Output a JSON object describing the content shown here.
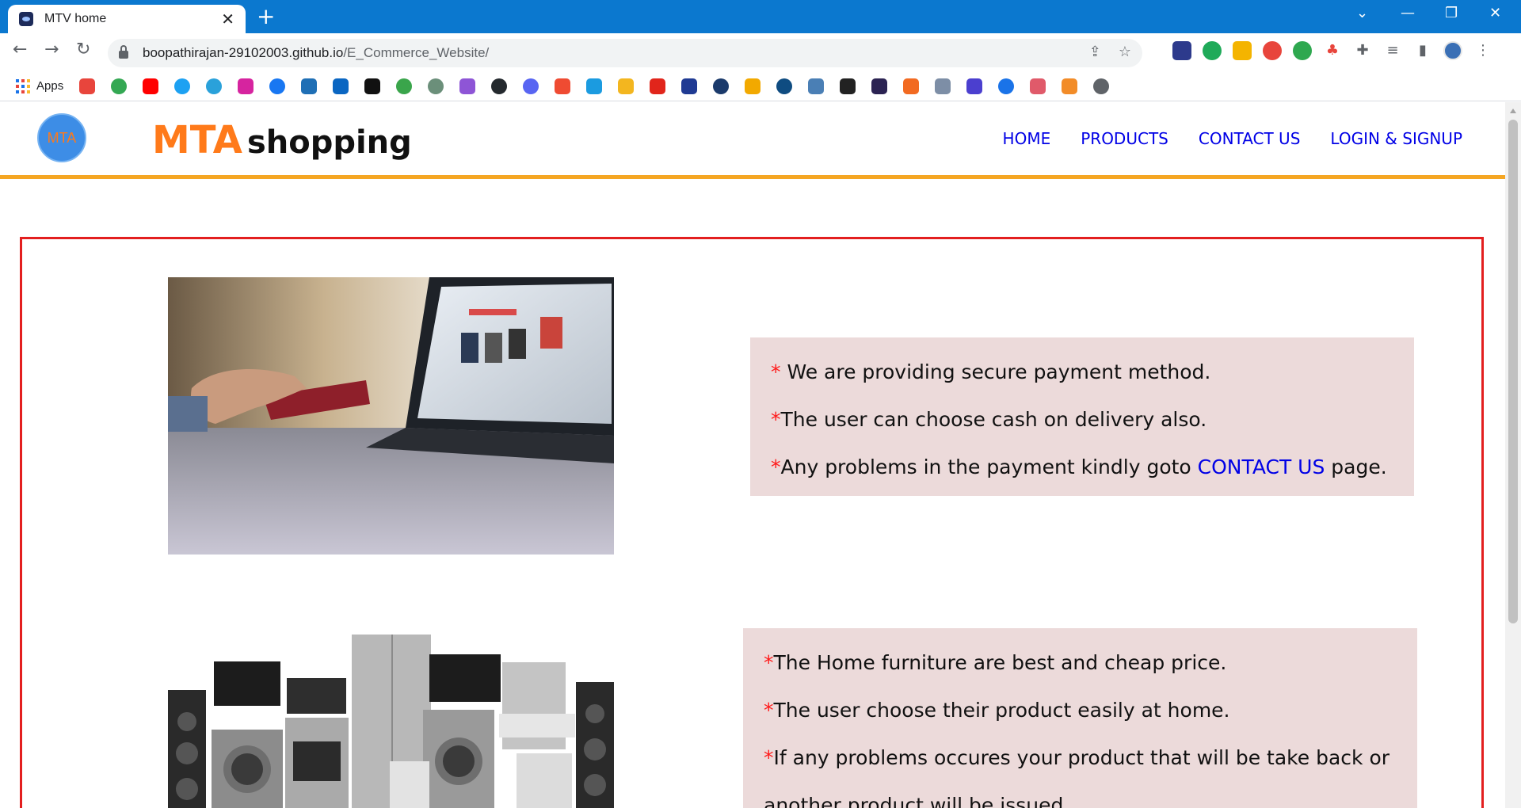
{
  "browser": {
    "tab_title": "MTV home",
    "tab_close": "✕",
    "new_tab": "+",
    "url_host": "boopathirajan-29102003.github.io",
    "url_path": "/E_Commerce_Website/",
    "bookmarks_apps_label": "Apps",
    "icons": [
      "back-icon",
      "forward-icon",
      "reload-icon",
      "lock-icon",
      "share-icon",
      "star-icon",
      "extensions-icon",
      "profile-avatar"
    ]
  },
  "header": {
    "logo_text": "MTA",
    "brand_main": "MTA",
    "brand_sub": "shopping",
    "nav": [
      "HOME",
      "PRODUCTS",
      "CONTACT US",
      "LOGIN & SIGNUP"
    ]
  },
  "section1": {
    "lines": [
      {
        "star": "*",
        "text": " We are providing secure payment method."
      },
      {
        "star": "*",
        "text": "The user can choose cash on delivery also."
      },
      {
        "star": "*",
        "text_before": "Any problems in the payment kindly goto ",
        "link": "CONTACT US",
        "text_after": " page."
      }
    ]
  },
  "section2": {
    "lines": [
      {
        "star": "*",
        "text": "The Home furniture are best and cheap price."
      },
      {
        "star": "*",
        "text": "The user choose their product easily at home."
      },
      {
        "star": "*",
        "text": "If any problems occures your product that will be take back or"
      },
      {
        "star": "",
        "text": "another product will be issued."
      }
    ]
  },
  "colors": {
    "chrome_blue": "#0b78cf",
    "accent_orange": "#ff7a1a",
    "header_border": "#f5a623",
    "nav_link": "#0000e6",
    "content_border": "#e31f1f",
    "info_bg": "#ecdada",
    "star_red": "#ff1a1a"
  }
}
